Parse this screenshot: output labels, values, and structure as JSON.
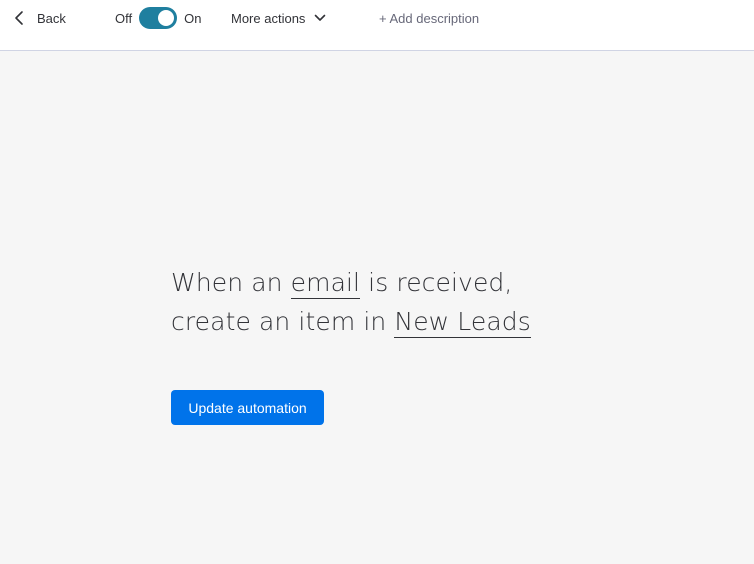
{
  "header": {
    "back_label": "Back",
    "toggle": {
      "off_label": "Off",
      "on_label": "On",
      "state": "on",
      "color": "#1f7f9f"
    },
    "more_actions_label": "More actions",
    "add_description_label": "+ Add description"
  },
  "recipe": {
    "line1_prefix": "When an",
    "trigger_token": "email",
    "line1_suffix": "is received,",
    "line2_prefix": "create an item in",
    "board_token": "New Leads"
  },
  "actions": {
    "update_label": "Update automation",
    "update_color": "#0073ea"
  },
  "icons": {
    "back": "chevron-left-icon",
    "dropdown": "chevron-down-icon"
  }
}
